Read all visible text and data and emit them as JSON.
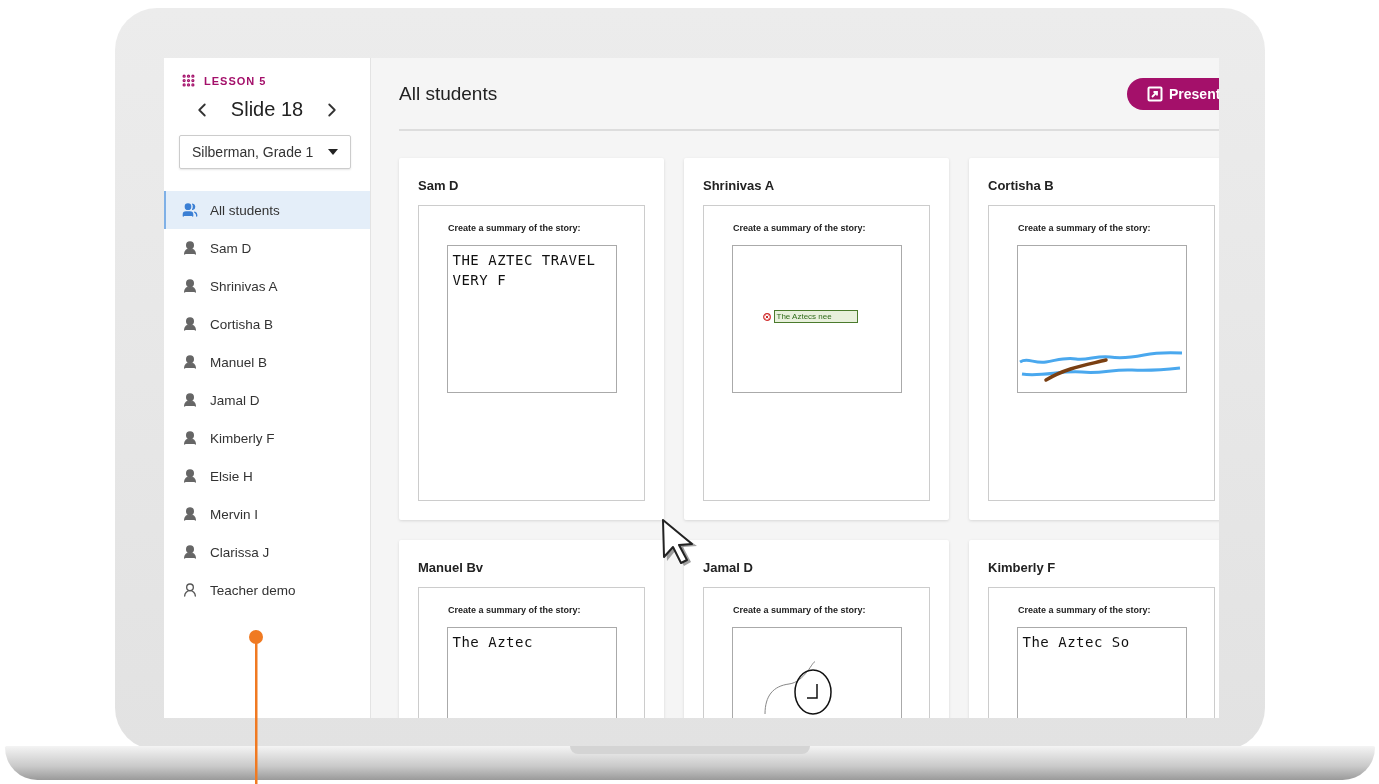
{
  "lesson": {
    "label": "LESSON 5"
  },
  "slide_nav": {
    "title": "Slide 18"
  },
  "class_select": {
    "value": "Silberman, Grade 1"
  },
  "sidebar": {
    "items": [
      {
        "kind": "group",
        "label": "All students",
        "selected": true
      },
      {
        "kind": "student",
        "label": "Sam D",
        "selected": false
      },
      {
        "kind": "student",
        "label": "Shrinivas A",
        "selected": false
      },
      {
        "kind": "student",
        "label": "Cortisha B",
        "selected": false
      },
      {
        "kind": "student",
        "label": "Manuel B",
        "selected": false
      },
      {
        "kind": "student",
        "label": "Jamal D",
        "selected": false
      },
      {
        "kind": "student",
        "label": "Kimberly F",
        "selected": false
      },
      {
        "kind": "student",
        "label": "Elsie H",
        "selected": false
      },
      {
        "kind": "student",
        "label": "Mervin I",
        "selected": false
      },
      {
        "kind": "student",
        "label": "Clarissa J",
        "selected": false
      },
      {
        "kind": "teacher",
        "label": "Teacher demo",
        "selected": false
      }
    ]
  },
  "main": {
    "title": "All students",
    "present_button": "Present"
  },
  "cards": [
    {
      "name": "Sam D",
      "prompt": "Create a summary of the story:",
      "answer": {
        "kind": "handwriting",
        "lines": [
          "THE AZTEC TRAVEL",
          "VERY F"
        ]
      }
    },
    {
      "name": "Shrinivas A",
      "prompt": "Create a summary of the story:",
      "answer": {
        "kind": "textbox",
        "text": "The Aztecs nee"
      }
    },
    {
      "name": "Cortisha B",
      "prompt": "Create a summary of the story:",
      "answer": {
        "kind": "waves"
      }
    },
    {
      "name": "Manuel Bv",
      "prompt": "Create a summary of the story:",
      "answer": {
        "kind": "handwriting",
        "lines": [
          "The Aztec"
        ]
      }
    },
    {
      "name": "Jamal D",
      "prompt": "Create a summary of the story:",
      "answer": {
        "kind": "circle"
      }
    },
    {
      "name": "Kimberly F",
      "prompt": "Create a summary of the story:",
      "answer": {
        "kind": "handwriting",
        "lines": [
          "The Aztec So"
        ]
      }
    }
  ]
}
